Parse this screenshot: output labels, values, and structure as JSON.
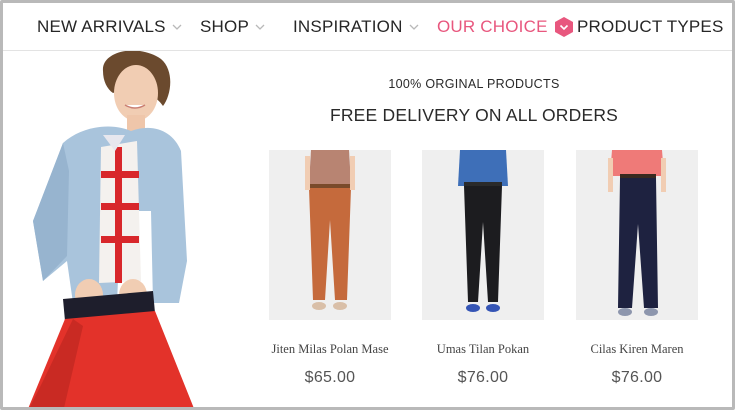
{
  "nav": {
    "items": [
      {
        "label": "NEW ARRIVALS",
        "has_dropdown": true
      },
      {
        "label": "SHOP",
        "has_dropdown": true
      },
      {
        "label": "INSPIRATION",
        "has_dropdown": true
      },
      {
        "label": "OUR CHOICE",
        "has_dropdown": true,
        "active": true
      },
      {
        "label": "PRODUCT TYPES",
        "has_dropdown": false
      }
    ],
    "active_color": "#e8577e",
    "badge_icon": "chevron-down-icon"
  },
  "hero": {
    "tagline": "100% ORGINAL PRODUCTS",
    "headline": "FREE DELIVERY ON ALL ORDERS"
  },
  "products": [
    {
      "name": "Jiten Milas Polan Mase",
      "price": "$65.00",
      "pants_color": "#c56a3c",
      "top_color": "#b88472",
      "shoe_color": "#d9bfa8"
    },
    {
      "name": "Umas Tilan Pokan",
      "price": "$76.00",
      "pants_color": "#1c1c1f",
      "top_color": "#3e6fb8",
      "shoe_color": "#3555b5"
    },
    {
      "name": "Cilas Kiren Maren",
      "price": "$76.00",
      "pants_color": "#1e2240",
      "top_color": "#ef7a78",
      "shoe_color": "#8d96ad"
    }
  ]
}
